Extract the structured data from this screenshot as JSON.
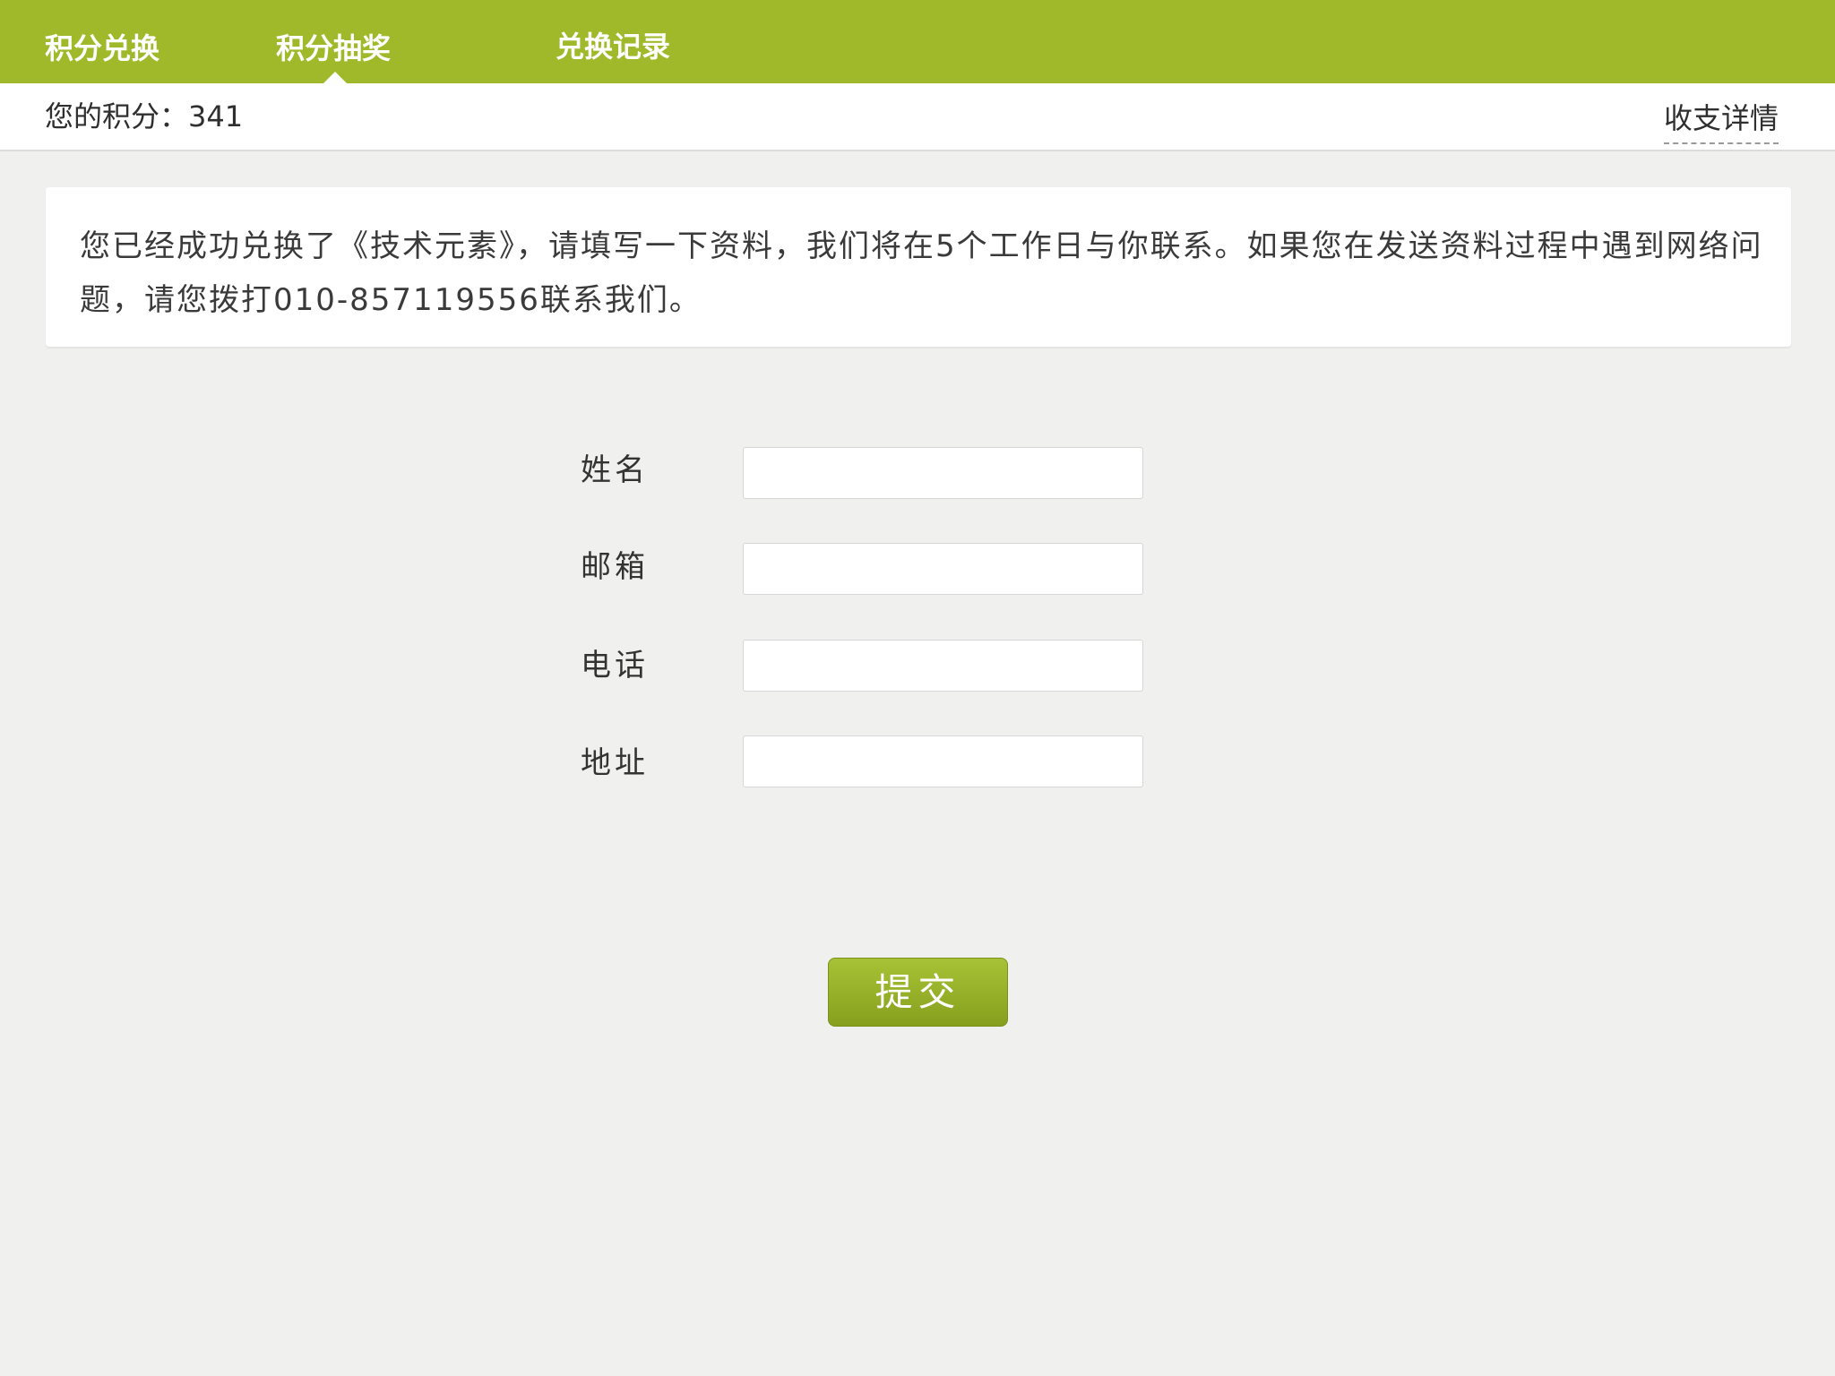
{
  "nav": {
    "tabs": [
      {
        "label": "积分兑换"
      },
      {
        "label": "积分抽奖"
      },
      {
        "label": "兑换记录"
      }
    ],
    "active_index": 1
  },
  "points": {
    "label": "您的积分：341",
    "detail_link": "收支详情"
  },
  "notice": {
    "text": "您已经成功兑换了《技术元素》，请填写一下资料，我们将在5个工作日与你联系。如果您在发送资料过程中遇到网络问题，请您拨打010-857119556联系我们。"
  },
  "form": {
    "fields": [
      {
        "label": "姓名",
        "value": ""
      },
      {
        "label": "邮箱",
        "value": ""
      },
      {
        "label": "电话",
        "value": ""
      },
      {
        "label": "地址",
        "value": ""
      }
    ],
    "submit_label": "提交"
  },
  "colors": {
    "brand": "#a0b92a",
    "background": "#f0f0ef"
  }
}
